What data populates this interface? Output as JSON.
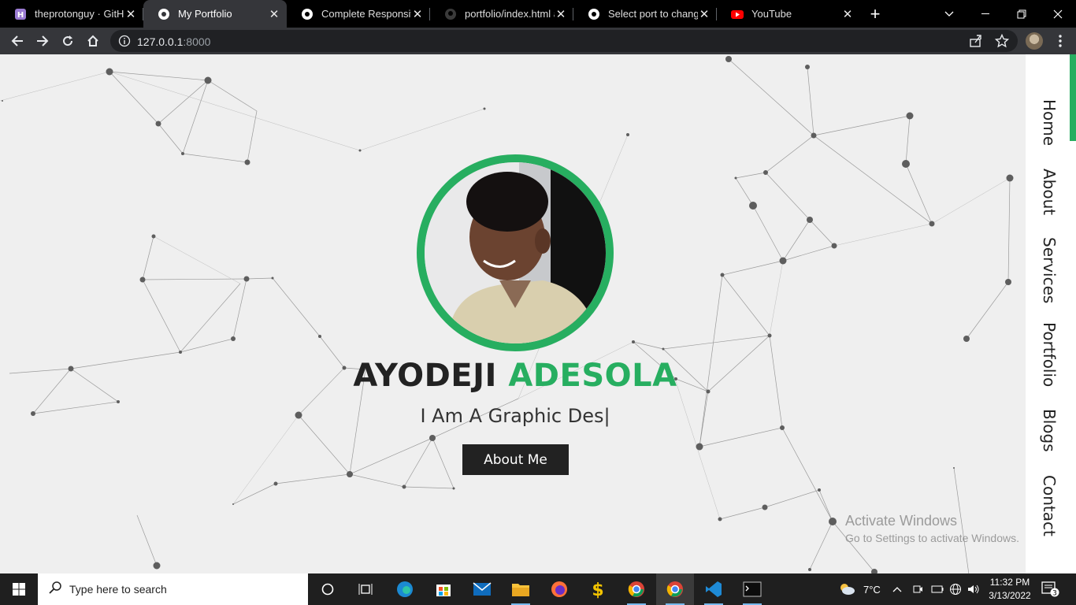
{
  "browser": {
    "tabs": [
      {
        "title": "theprotonguy · GitHub",
        "icon": "heroku-icon",
        "active": false
      },
      {
        "title": "My Portfolio",
        "icon": "globe-icon",
        "active": true
      },
      {
        "title": "Complete Responsive",
        "icon": "globe-icon",
        "active": false
      },
      {
        "title": "portfolio/index.html a",
        "icon": "github-icon",
        "active": false
      },
      {
        "title": "Select port to change",
        "icon": "globe-icon",
        "active": false
      },
      {
        "title": "YouTube",
        "icon": "youtube-icon",
        "active": false
      }
    ],
    "address": {
      "host": "127.0.0.1",
      "port": ":8000"
    }
  },
  "page": {
    "first_name": "AYODEJI",
    "last_name": "ADESOLA",
    "typed_text": "I Am A Graphic Des|",
    "cta_label": "About Me",
    "accent_color": "#27ae60",
    "nav": [
      "Home",
      "About",
      "Services",
      "Portfolio",
      "Blogs",
      "Contact"
    ]
  },
  "watermark": {
    "line1": "Activate Windows",
    "line2": "Go to Settings to activate Windows."
  },
  "taskbar": {
    "search_placeholder": "Type here to search",
    "weather": "7°C",
    "time": "11:32 PM",
    "date": "3/13/2022",
    "notifications": "3"
  }
}
